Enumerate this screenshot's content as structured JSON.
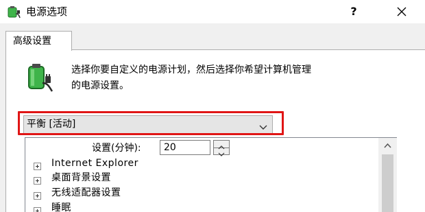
{
  "window": {
    "title": "电源选项",
    "help_label": "?",
    "icon": "power-options-icon",
    "close_icon": "close-icon"
  },
  "tabs": [
    {
      "label": "高级设置",
      "active": true
    }
  ],
  "description": {
    "line1": "选择你要自定义的电源计划，然后选择你希望计算机管理",
    "line2": "的电源设置。",
    "icon": "battery-plan-icon"
  },
  "plan_dropdown": {
    "selected": "平衡 [活动]",
    "icon": "chevron-down-icon"
  },
  "highlight": {
    "color": "#e01515"
  },
  "settings_tree": {
    "setting_label": "设置(分钟):",
    "setting_value": "20",
    "items": [
      {
        "label": "Internet Explorer",
        "expander": "+"
      },
      {
        "label": "桌面背景设置",
        "expander": "+"
      },
      {
        "label": "无线适配器设置",
        "expander": "+"
      },
      {
        "label": "睡眠",
        "expander": "+"
      }
    ]
  },
  "colors": {
    "background": "#f0f0f0",
    "panel": "#ffffff",
    "dropdown": "#e5e5e5",
    "battery_green": "#3fb44a"
  }
}
